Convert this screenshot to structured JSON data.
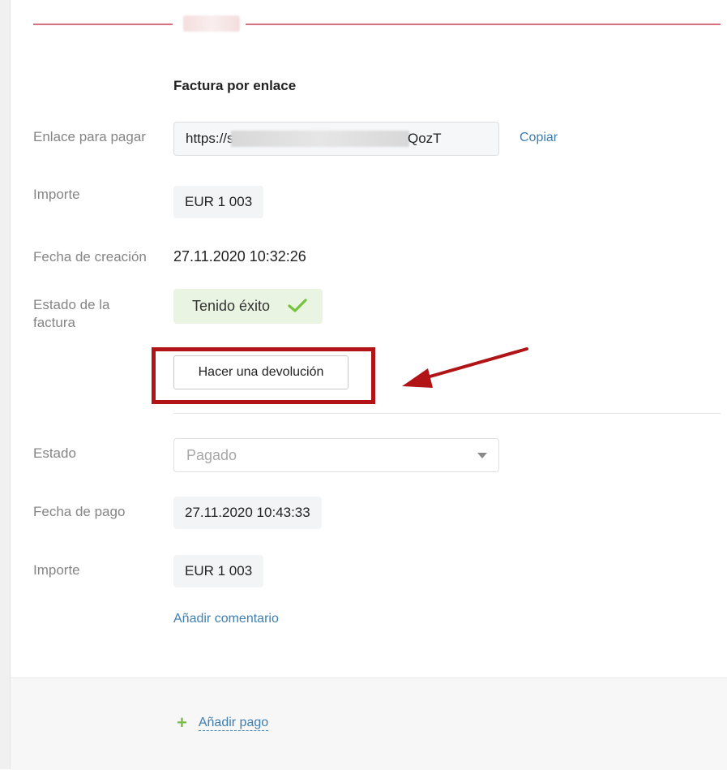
{
  "section": {
    "title": "Factura por enlace"
  },
  "invoice": {
    "link_label": "Enlace para pagar",
    "link_value_prefix": "https://s",
    "link_value_suffix": "QozT",
    "copy_label": "Copiar",
    "amount_label": "Importe",
    "amount_value": "EUR 1 003",
    "created_label": "Fecha de creación",
    "created_value": "27.11.2020 10:32:26",
    "status_label": "Estado de la factura",
    "status_value": "Tenido éxito",
    "refund_button_label": "Hacer una devolución"
  },
  "payment": {
    "state_label": "Estado",
    "state_value": "Pagado",
    "date_label": "Fecha de pago",
    "date_value": "27.11.2020 10:43:33",
    "amount_label": "Importe",
    "amount_value": "EUR 1 003",
    "add_comment_label": "Añadir comentario"
  },
  "footer": {
    "add_payment_label": "Añadir pago",
    "add_payment_icon": "plus-icon"
  },
  "colors": {
    "accent_line": "#d9707e",
    "link": "#3f7eb1",
    "success_bg": "#e9f5e2",
    "success_check": "#74c33e",
    "annotation_red": "#b01417"
  }
}
